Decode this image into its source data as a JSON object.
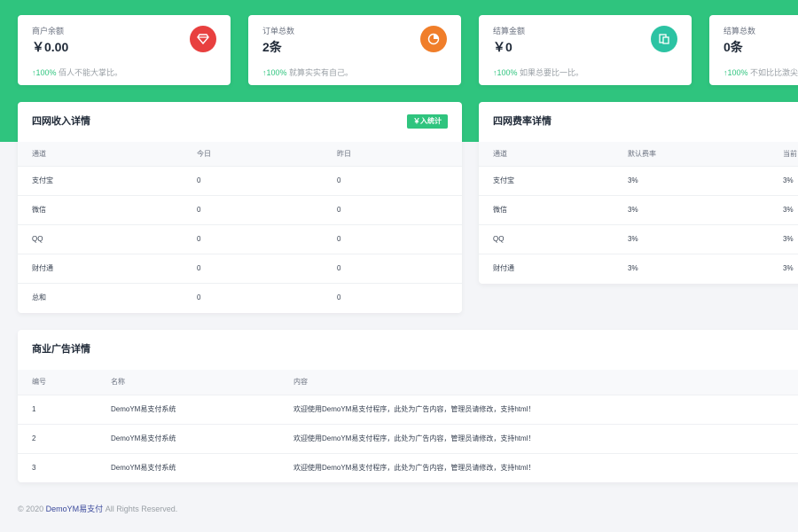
{
  "stats": [
    {
      "label": "商户余额",
      "value": "￥0.00",
      "pct": "100%",
      "note": "佰人不能大掌比。",
      "icon": "diamond-icon",
      "color": "#e8403f"
    },
    {
      "label": "订单总数",
      "value": "2条",
      "pct": "100%",
      "note": "就算实实有自己。",
      "icon": "pie-chart-icon",
      "color": "#f07e2a"
    },
    {
      "label": "结算金额",
      "value": "￥0",
      "pct": "100%",
      "note": "如果总要比一比。",
      "icon": "document-icon",
      "color": "#2cc3a3"
    },
    {
      "label": "结算总数",
      "value": "0条",
      "pct": "100%",
      "note": "不如比比激尖",
      "icon": "chart-icon",
      "color": "#3b82f6"
    }
  ],
  "income": {
    "title": "四网收入详情",
    "badge": "￥入统计",
    "headers": [
      "通道",
      "今日",
      "昨日"
    ],
    "rows": [
      [
        "支付宝",
        "0",
        "0"
      ],
      [
        "微信",
        "0",
        "0"
      ],
      [
        "QQ",
        "0",
        "0"
      ],
      [
        "财付通",
        "0",
        "0"
      ],
      [
        "总和",
        "0",
        "0"
      ]
    ]
  },
  "rates": {
    "title": "四网费率详情",
    "headers": [
      "通道",
      "默认费率",
      "当前"
    ],
    "rows": [
      [
        "支付宝",
        "3%",
        "3%"
      ],
      [
        "微信",
        "3%",
        "3%"
      ],
      [
        "QQ",
        "3%",
        "3%"
      ],
      [
        "财付通",
        "3%",
        "3%"
      ]
    ]
  },
  "ads": {
    "title": "商业广告详情",
    "headers": [
      "编号",
      "名称",
      "内容"
    ],
    "rows": [
      [
        "1",
        "DemoYM易支付系统",
        "欢迎使用DemoYM易支付程序，此处为广告内容，管理员请修改，支持html！"
      ],
      [
        "2",
        "DemoYM易支付系统",
        "欢迎使用DemoYM易支付程序，此处为广告内容，管理员请修改，支持html！"
      ],
      [
        "3",
        "DemoYM易支付系统",
        "欢迎使用DemoYM易支付程序，此处为广告内容，管理员请修改，支持html！"
      ]
    ]
  },
  "footer": {
    "prefix": "© 2020",
    "brand": "DemoYM易支付",
    "suffix": "All Rights Reserved."
  }
}
